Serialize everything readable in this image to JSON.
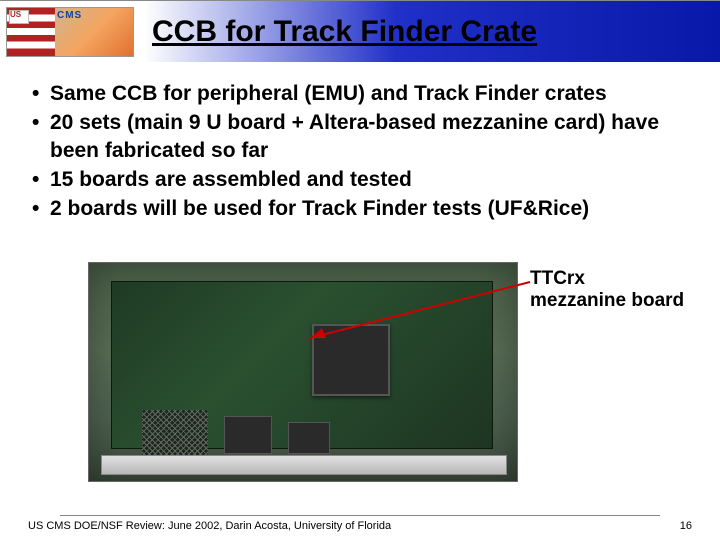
{
  "header": {
    "logo_us": "US",
    "logo_cms": "CMS",
    "title": "CCB  for Track Finder Crate"
  },
  "bullets": [
    "Same CCB  for peripheral (EMU) and Track Finder  crates",
    "20 sets (main 9 U board + Altera-based mezzanine card) have  been fabricated so far",
    "15  boards  are assembled  and  tested",
    "2 boards will be used for Track Finder tests (UF&Rice)"
  ],
  "callout": {
    "line1": "TTCrx",
    "line2": "mezzanine board"
  },
  "footer": {
    "text": "US CMS DOE/NSF Review:  June 2002,  Darin Acosta, University of Florida",
    "page": "16"
  }
}
